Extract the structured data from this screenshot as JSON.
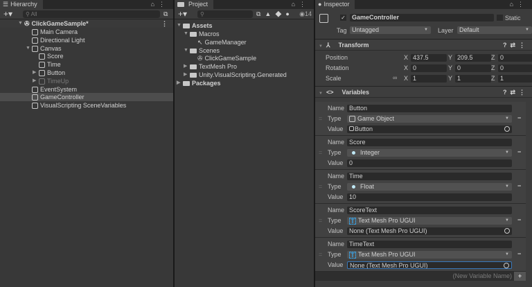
{
  "hierarchy": {
    "tab": "Hierarchy",
    "search_placeholder": "All",
    "scene": "ClickGameSample*",
    "items": [
      "Main Camera",
      "Directional Light",
      "Canvas",
      "Score",
      "Time",
      "Button",
      "TimeUp",
      "EventSystem",
      "GameController",
      "VisualScripting SceneVariables"
    ]
  },
  "project": {
    "tab": "Project",
    "hidden_count": "14",
    "items": [
      "Assets",
      "Macros",
      "GameManager",
      "Scenes",
      "ClickGameSample",
      "TextMesh Pro",
      "Unity.VisualScripting.Generated",
      "Packages"
    ]
  },
  "inspector": {
    "tab": "Inspector",
    "object_name": "GameController",
    "static_label": "Static",
    "tag_label": "Tag",
    "tag_value": "Untagged",
    "layer_label": "Layer",
    "layer_value": "Default",
    "transform": {
      "title": "Transform",
      "rows": [
        {
          "label": "Position",
          "x": "437.5",
          "y": "209.5",
          "z": "0"
        },
        {
          "label": "Rotation",
          "x": "0",
          "y": "0",
          "z": "0"
        },
        {
          "label": "Scale",
          "x": "1",
          "y": "1",
          "z": "1"
        }
      ],
      "axis_x": "X",
      "axis_y": "Y",
      "axis_z": "Z"
    },
    "variables": {
      "title": "Variables",
      "name_label": "Name",
      "type_label": "Type",
      "value_label": "Value",
      "new_placeholder": "(New Variable Name)",
      "items": [
        {
          "name": "Button",
          "type": "Game Object",
          "value": "Button",
          "icon": "cube"
        },
        {
          "name": "Score",
          "type": "Integer",
          "value": "0",
          "icon": "dot"
        },
        {
          "name": "Time",
          "type": "Float",
          "value": "10",
          "icon": "dot"
        },
        {
          "name": "ScoreText",
          "type": "Text Mesh Pro UGUI",
          "value": "None (Text Mesh Pro UGUI)",
          "icon": "tmp"
        },
        {
          "name": "TimeText",
          "type": "Text Mesh Pro UGUI",
          "value": "None (Text Mesh Pro UGUI)",
          "icon": "tmp"
        }
      ]
    }
  },
  "colors": {
    "accent": "#3aa0e0",
    "selection": "#4d4d4d"
  }
}
